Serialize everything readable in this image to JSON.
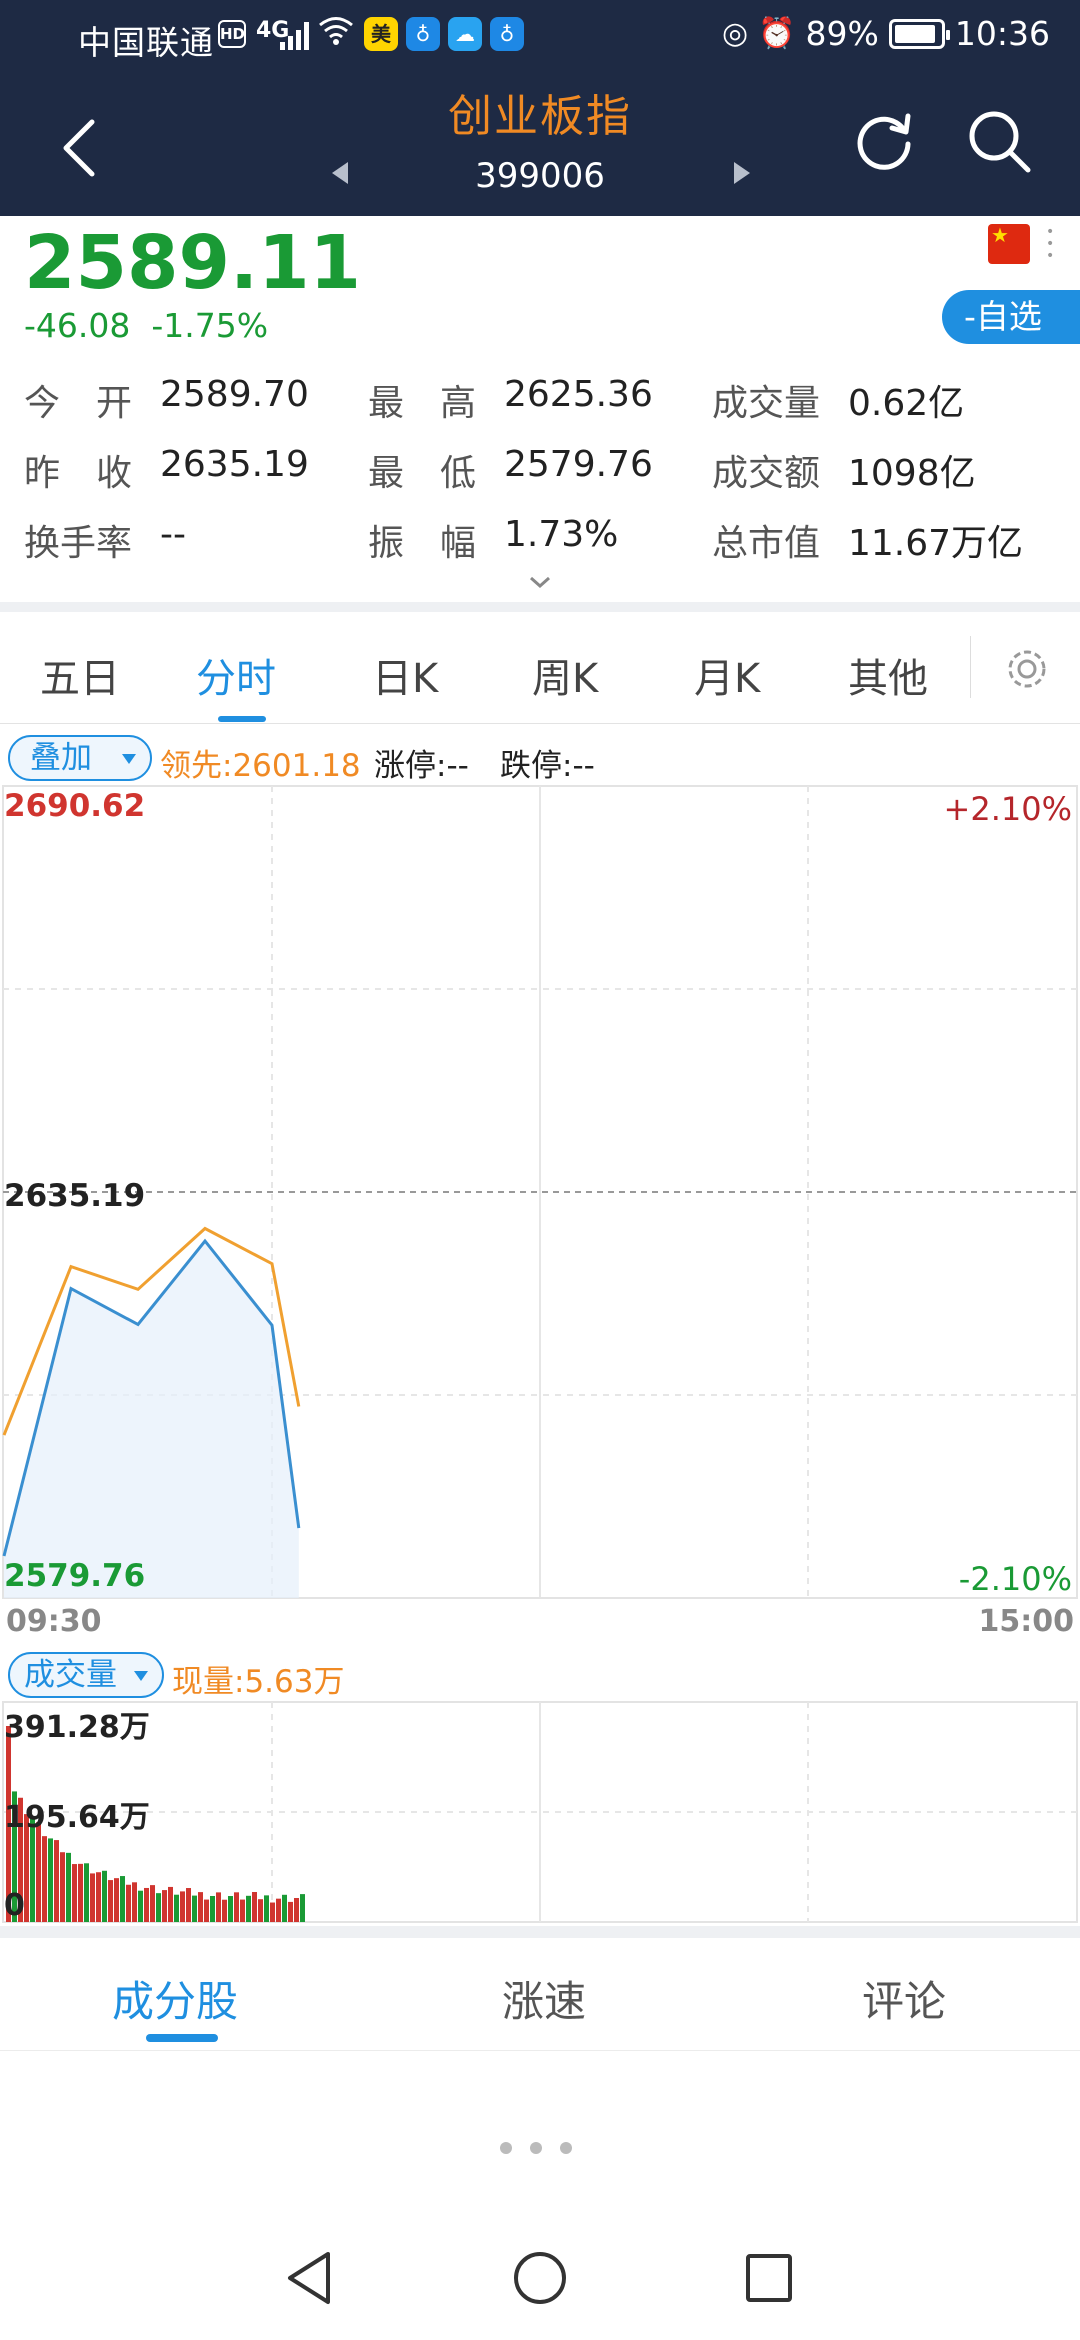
{
  "status": {
    "carrier": "中国联通",
    "hd": "HD",
    "network": "4G",
    "battery": "89%",
    "time": "10:36",
    "app_meituan": "美"
  },
  "header": {
    "title": "创业板指",
    "code": "399006"
  },
  "quote": {
    "price": "2589.11",
    "change": "-46.08",
    "change_pct": "-1.75%",
    "watch_label": "-自选",
    "stats": [
      [
        {
          "label": "今　开",
          "value": "2589.70"
        },
        {
          "label": "最　高",
          "value": "2625.36"
        },
        {
          "label": "成交量",
          "value": "0.62亿"
        }
      ],
      [
        {
          "label": "昨　收",
          "value": "2635.19"
        },
        {
          "label": "最　低",
          "value": "2579.76"
        },
        {
          "label": "成交额",
          "value": "1098亿"
        }
      ],
      [
        {
          "label": "换手率",
          "value": "--"
        },
        {
          "label": "振　幅",
          "value": "1.73%"
        },
        {
          "label": "总市值",
          "value": "11.67万亿"
        }
      ]
    ]
  },
  "tabs": [
    "五日",
    "分时",
    "日K",
    "周K",
    "月K",
    "其他"
  ],
  "active_tab": "分时",
  "overlay": {
    "button": "叠加",
    "leader": "领先:2601.18",
    "limit_up": "涨停:--",
    "limit_down": "跌停:--"
  },
  "volume": {
    "button": "成交量",
    "now": "现量:5.63万",
    "labels": [
      "391.28万",
      "195.64万",
      "0"
    ]
  },
  "bottom_tabs": [
    "成分股",
    "涨速",
    "评论"
  ],
  "colors": {
    "up": "#d0352f",
    "down": "#1a9a35",
    "accent": "#1f8fe0",
    "leader_line": "#f0a030",
    "header_bg": "#1e2a44",
    "title": "#f08a24"
  },
  "chart_data": {
    "type": "line",
    "x": [
      "09:30",
      "09:45",
      "10:00",
      "10:15",
      "10:30",
      "10:36"
    ],
    "time_labels": [
      "09:30",
      "15:00"
    ],
    "ylim": [
      2579.76,
      2690.62
    ],
    "reference": 2635.19,
    "y_labels": {
      "top": "2690.62",
      "mid": "2635.19",
      "bottom": "2579.76"
    },
    "pct_labels": {
      "top": "+2.10%",
      "bottom": "-2.10%"
    },
    "series": [
      {
        "name": "",
        "values": [
          2585.5,
          2622.0,
          2617.1,
          2628.5,
          2617.0,
          2589.3
        ]
      },
      {
        "name": "",
        "values": [
          2602.0,
          2625.0,
          2621.9,
          2630.2,
          2625.4,
          2605.9
        ]
      }
    ]
  }
}
